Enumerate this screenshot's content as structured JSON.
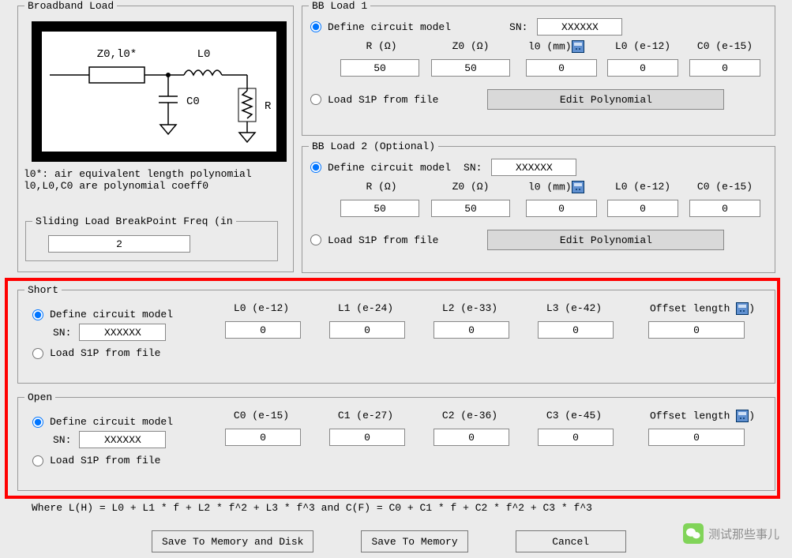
{
  "broadband": {
    "title": "Broadband Load",
    "diagram": {
      "Z0l0": "Z0,l0*",
      "L0": "L0",
      "C0": "C0",
      "R": "R"
    },
    "caption_line1": "l0*: air equivalent length polynomial",
    "caption_line2": "l0,L0,C0 are polynomial coeff0",
    "sliding_title": "Sliding Load BreakPoint Freq (in",
    "sliding_value": "2"
  },
  "bb1": {
    "title": "BB Load 1",
    "define": "Define circuit model",
    "sn_label": "SN:",
    "sn": "XXXXXX",
    "heads": {
      "R": "R (Ω)",
      "Z0": "Z0 (Ω)",
      "l0": "l0 (mm)",
      "L0": "L0 (e-12)",
      "C0": "C0 (e-15)"
    },
    "vals": {
      "R": "50",
      "Z0": "50",
      "l0": "0",
      "L0": "0",
      "C0": "0"
    },
    "load_s1p": "Load S1P from file",
    "editpoly": "Edit Polynomial"
  },
  "bb2": {
    "title": "BB Load 2 (Optional)",
    "define": "Define circuit model",
    "sn_label": "SN:",
    "sn": "XXXXXX",
    "heads": {
      "R": "R (Ω)",
      "Z0": "Z0 (Ω)",
      "l0": "l0 (mm)",
      "L0": "L0 (e-12)",
      "C0": "C0 (e-15)"
    },
    "vals": {
      "R": "50",
      "Z0": "50",
      "l0": "0",
      "L0": "0",
      "C0": "0"
    },
    "load_s1p": "Load S1P from file",
    "editpoly": "Edit Polynomial"
  },
  "short": {
    "title": "Short",
    "define": "Define circuit model",
    "sn_label": "SN:",
    "sn": "XXXXXX",
    "heads": {
      "L0": "L0 (e-12)",
      "L1": "L1 (e-24)",
      "L2": "L2 (e-33)",
      "L3": "L3 (e-42)",
      "off": "Offset length "
    },
    "vals": {
      "L0": "0",
      "L1": "0",
      "L2": "0",
      "L3": "0",
      "off": "0"
    },
    "load_s1p": "Load S1P from file"
  },
  "open": {
    "title": "Open",
    "define": "Define circuit model",
    "sn_label": "SN:",
    "sn": "XXXXXX",
    "heads": {
      "C0": "C0 (e-15)",
      "C1": "C1 (e-27)",
      "C2": "C2 (e-36)",
      "C3": "C3 (e-45)",
      "off": "Offset length "
    },
    "vals": {
      "C0": "0",
      "C1": "0",
      "C2": "0",
      "C3": "0",
      "off": "0"
    },
    "load_s1p": "Load S1P from file"
  },
  "footer": {
    "formula": "Where L(H) = L0 + L1 * f + L2 * f^2 + L3 * f^3   and   C(F) = C0 + C1 * f + C2 * f^2 + C3 * f^3",
    "save_disk": "Save To Memory and Disk",
    "save_mem": "Save To Memory",
    "cancel": "Cancel"
  },
  "misc": {
    "paren_close": ")"
  },
  "watermark": "测试那些事儿"
}
